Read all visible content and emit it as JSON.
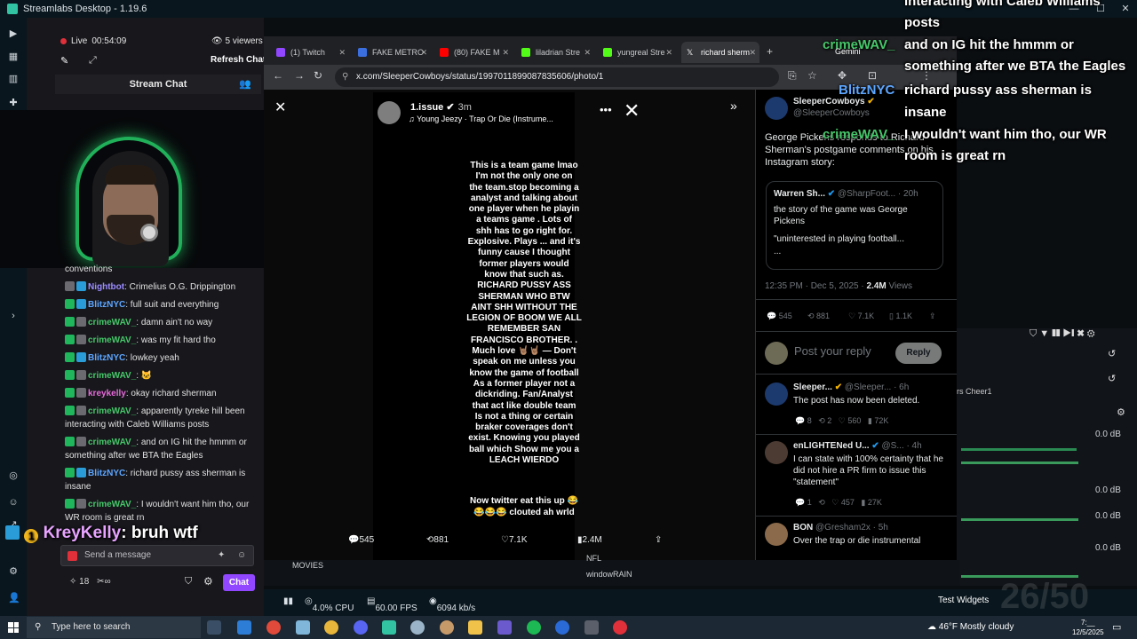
{
  "app": {
    "title": "Streamlabs Desktop - 1.19.6"
  },
  "chat": {
    "live_label": "Live",
    "live_time": "00:54:09",
    "viewers": "5 viewers",
    "refresh": "Refresh Chat",
    "header": "Stream Chat",
    "messages": [
      {
        "user": "",
        "text": "conventions"
      },
      {
        "user": "Nightbot",
        "text": ": Crimelius O.G. Drippington"
      },
      {
        "user": "BlitzNYC",
        "text": ": full suit and everything"
      },
      {
        "user": "crimeWAV_",
        "text": ": damn ain't no way"
      },
      {
        "user": "crimeWAV_",
        "text": ": was my fit hard tho"
      },
      {
        "user": "BlitzNYC",
        "text": ": lowkey yeah"
      },
      {
        "user": "crimeWAV_",
        "text": ":"
      },
      {
        "user": "kreykelly",
        "text": ": okay richard sherman"
      },
      {
        "user": "crimeWAV_",
        "text": ": apparently tyreke hill been interacting with Caleb Williams posts"
      },
      {
        "user": "crimeWAV_",
        "text": ": and on IG hit the hmmm or something after we BTA the Eagles"
      },
      {
        "user": "BlitzNYC",
        "text": ": richard pussy ass sherman is insane"
      },
      {
        "user": "crimeWAV_",
        "text": ": I wouldn't want him tho, our WR room is great rn"
      }
    ],
    "overlay_user": "KreyKelly",
    "overlay_text": ": bruh wtf",
    "overlay_badge": "1",
    "input_placeholder": "Send a message",
    "points": "18",
    "infinity": "∞",
    "chat_button": "Chat"
  },
  "browser": {
    "tabs": [
      {
        "label": "(1) Twitch",
        "color": "#9147ff"
      },
      {
        "label": "FAKE METRO",
        "color": "#3b6fe0"
      },
      {
        "label": "(80) FAKE M",
        "color": "#ff0000"
      },
      {
        "label": "liladrian Stre",
        "color": "#53fc18"
      },
      {
        "label": "yungreal Stre",
        "color": "#53fc18"
      },
      {
        "label": "richard sherm",
        "color": "#ffffff"
      }
    ],
    "url": "x.com/SleeperCowboys/status/1997011899087835606/photo/1"
  },
  "story": {
    "user": "1.issue",
    "time": "3m",
    "song": "Young Jeezy · Trap Or Die (Instrume...",
    "body": "This is a team game lmao\nI'm not the only one on\nthe team.stop becoming a\nanalyst and talking about\none player when he playin\na teams game . Lots of\nshh has to go right for.\nExplosive. Plays ... and it's\nfunny cause I thought\nformer players would\nknow that such as.\nRICHARD PUSSY ASS\nSHERMAN WHO BTW\nAINT SHH WITHOUT THE\nLEGION OF BOOM WE ALL\nREMEMBER SAN\nFRANCISCO BROTHER. .\nMuch love 🤘🏽🤘🏽 — Don't\nspeak on me unless you\nknow the game of football\nAs a former player not a\ndickriding. Fan/Analyst\nthat act like double team\nIs not a thing or certain\nbraker coverages don't\nexist. Knowing you played\nball which Show me you a\nLEACH WIERDO",
    "footer": "Now twitter eat this up 😂\n😂😂😂 clouted ah wrld",
    "replies": "545",
    "reposts": "881",
    "likes": "7.1K",
    "views": "2.4M"
  },
  "tweet": {
    "author": "SleeperCowboys",
    "handle": "@SleeperCowboys",
    "text": "George Pickens responds to Richard Sherman's postgame comments on his Instagram story:",
    "quote_author": "Warren Sh...",
    "quote_handle": "@SharpFoot...",
    "quote_time": "· 20h",
    "quote_text": "the story of the game was George Pickens",
    "quote_text2": "\"uninterested in playing football...",
    "quote_more": "...",
    "meta": "12:35 PM · Dec 5, 2025 ·",
    "views": "2.4M",
    "views_label": "Views",
    "replies": "545",
    "reposts": "881",
    "likes": "7.1K",
    "bookmarks": "1.1K",
    "reply_placeholder": "Post your reply",
    "reply_button": "Reply"
  },
  "replies": [
    {
      "name": "Sleeper...",
      "handle": "@Sleeper...",
      "time": "· 6h",
      "text": "The post has now been deleted.",
      "r": "8",
      "rt": "2",
      "l": "560",
      "v": "72K"
    },
    {
      "name": "enLIGHTENed U...",
      "handle": "@S...",
      "time": "· 4h",
      "text": "I can state with 100% certainty that he did not hire a PR firm to issue this \"statement\"",
      "r": "1",
      "rt": "",
      "l": "457",
      "v": "27K"
    },
    {
      "name": "BON",
      "handle": "@Gresham2x",
      "time": "· 5h",
      "text": "Over the trap or die instrumental",
      "r": "",
      "rt": "",
      "l": "",
      "v": ""
    }
  ],
  "overlay": {
    "lines": [
      "interacting with Caleb Williams",
      "posts",
      "and on IG hit the hmmm or",
      "something after we BTA the Eagles",
      "richard pussy ass sherman is",
      "insane",
      "I wouldn't want him tho, our WR",
      "room is great rn"
    ],
    "users": [
      "crimeWAV_",
      "BlitzNYC",
      "crimeWAV_"
    ],
    "gemini": "Gemini"
  },
  "mixer": {
    "cheer": "rs Cheer1",
    "db1": "0.0 dB",
    "db2": "0.0 dB",
    "db3": "0.0 dB",
    "db4": "0.0 dB"
  },
  "bottom": {
    "movies": "MOVIES",
    "window": "windowRAIN",
    "nfl": "NFL"
  },
  "status": {
    "cpu": "4.0% CPU",
    "fps": "60.00 FPS",
    "kbps": "6094 kb/s",
    "test_widgets": "Test Widgets",
    "watermark": "26/50"
  },
  "taskbar": {
    "search": "Type here to search",
    "weather": "46°F  Mostly cloudy",
    "time": "7:__",
    "date": "12/5/2025"
  }
}
